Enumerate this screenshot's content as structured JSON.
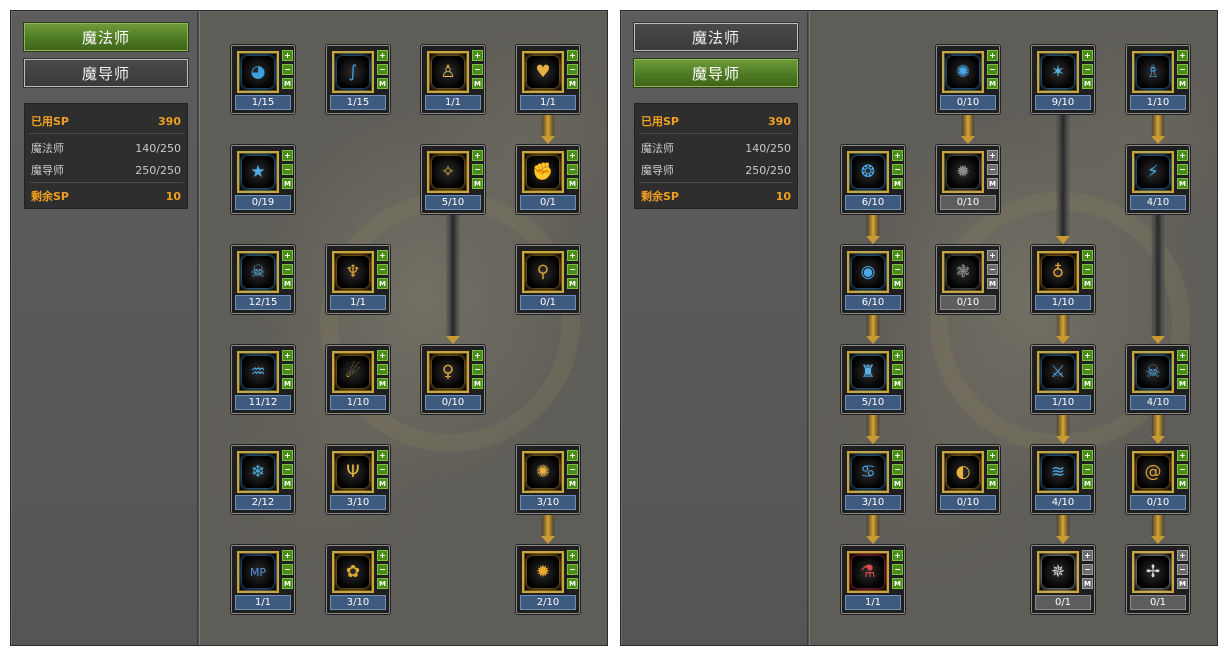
{
  "panels": [
    {
      "tabs": [
        {
          "label": "魔法师",
          "active": true
        },
        {
          "label": "魔导师",
          "active": false
        }
      ],
      "sp": {
        "used_label": "已用SP",
        "used_value": "390",
        "classes": [
          {
            "name": "魔法师",
            "value": "140/250"
          },
          {
            "name": "魔导师",
            "value": "250/250"
          }
        ],
        "remain_label": "剩余SP",
        "remain_value": "10"
      },
      "skills": [
        {
          "icon": "shield-orb-icon",
          "glyph": "◕",
          "color": "#3aa0e0",
          "level": "1/15"
        },
        {
          "icon": "swirl-sword-icon",
          "glyph": "∫",
          "color": "#4a9ad8",
          "level": "1/15"
        },
        {
          "icon": "walking-figure-icon",
          "glyph": "♙",
          "color": "#e0b050",
          "level": "1/1"
        },
        {
          "icon": "golden-heart-icon",
          "glyph": "♥",
          "color": "#e8b040",
          "level": "1/1"
        },
        {
          "icon": "star-burst-icon",
          "glyph": "★",
          "color": "#4ab0e8",
          "level": "0/19"
        },
        {
          "icon": "golden-compass-icon",
          "glyph": "✧",
          "color": "#d8a030",
          "level": "5/10"
        },
        {
          "icon": "golden-fist-icon",
          "glyph": "✊",
          "color": "#e0a838",
          "level": "0/1"
        },
        {
          "icon": "skull-icon",
          "glyph": "☠",
          "color": "#58b8e8",
          "level": "12/15"
        },
        {
          "icon": "golden-totem-icon",
          "glyph": "♆",
          "color": "#e0a030",
          "level": "1/1"
        },
        {
          "icon": "golden-arm-icon",
          "glyph": "⚲",
          "color": "#d8a030",
          "level": "0/1"
        },
        {
          "icon": "ice-demon-icon",
          "glyph": "♒",
          "color": "#4aa8e0",
          "level": "11/12"
        },
        {
          "icon": "fire-orb-icon",
          "glyph": "☄",
          "color": "#e0a030",
          "level": "1/10"
        },
        {
          "icon": "golden-man-icon",
          "glyph": "♀",
          "color": "#d8a838",
          "level": "0/10"
        },
        {
          "icon": "ice-crystal-icon",
          "glyph": "❄",
          "color": "#4ab0e8",
          "level": "2/12"
        },
        {
          "icon": "golden-claw-icon",
          "glyph": "Ψ",
          "color": "#e0b040",
          "level": "3/10"
        },
        {
          "icon": "golden-lotus-icon",
          "glyph": "✺",
          "color": "#e8b040",
          "level": "3/10"
        },
        {
          "icon": "mp-potion-icon",
          "glyph": "MP",
          "color": "#4a90e0",
          "level": "1/1"
        },
        {
          "icon": "golden-flower-icon",
          "glyph": "✿",
          "color": "#e0a838",
          "level": "3/10"
        },
        {
          "icon": "golden-flame-icon",
          "glyph": "✹",
          "color": "#e8a830",
          "level": "2/10"
        }
      ]
    },
    {
      "tabs": [
        {
          "label": "魔法师",
          "active": false
        },
        {
          "label": "魔导师",
          "active": true
        }
      ],
      "sp": {
        "used_label": "已用SP",
        "used_value": "390",
        "classes": [
          {
            "name": "魔法师",
            "value": "140/250"
          },
          {
            "name": "魔导师",
            "value": "250/250"
          }
        ],
        "remain_label": "剩余SP",
        "remain_value": "10"
      },
      "skills": [
        {
          "icon": "frost-sphere-icon",
          "glyph": "✺",
          "color": "#48a8e8",
          "level": "0/10"
        },
        {
          "icon": "ice-wings-icon",
          "glyph": "✶",
          "color": "#58b0e8",
          "level": "9/10"
        },
        {
          "icon": "ice-figure-icon",
          "glyph": "♗",
          "color": "#48a0e0",
          "level": "1/10"
        },
        {
          "icon": "bubble-orbs-icon",
          "glyph": "❂",
          "color": "#4aa8e8",
          "level": "6/10"
        },
        {
          "icon": "dark-orb-icon",
          "glyph": "✹",
          "color": "#8a8a8a",
          "level": "0/10"
        },
        {
          "icon": "ice-burst-icon",
          "glyph": "⚡",
          "color": "#4aa8e8",
          "level": "4/10"
        },
        {
          "icon": "spiral-ice-icon",
          "glyph": "◉",
          "color": "#4aa8e8",
          "level": "6/10"
        },
        {
          "icon": "dark-vortex-icon",
          "glyph": "❃",
          "color": "#8a8a8a",
          "level": "0/10"
        },
        {
          "icon": "golden-pot-icon",
          "glyph": "♁",
          "color": "#e0a030",
          "level": "1/10"
        },
        {
          "icon": "ice-tower-icon",
          "glyph": "♜",
          "color": "#58b0e8",
          "level": "5/10"
        },
        {
          "icon": "ice-blade-icon",
          "glyph": "⚔",
          "color": "#4aa0e0",
          "level": "1/10"
        },
        {
          "icon": "ice-skull-icon",
          "glyph": "☠",
          "color": "#58b0e8",
          "level": "4/10"
        },
        {
          "icon": "ice-mask-icon",
          "glyph": "♋",
          "color": "#4aa8e8",
          "level": "3/10"
        },
        {
          "icon": "golden-ring-icon",
          "glyph": "◐",
          "color": "#e8b040",
          "level": "0/10"
        },
        {
          "icon": "ice-wave-icon",
          "glyph": "≋",
          "color": "#48a8e8",
          "level": "4/10"
        },
        {
          "icon": "golden-spiral-icon",
          "glyph": "@",
          "color": "#e0a030",
          "level": "0/10"
        },
        {
          "icon": "red-potion-icon",
          "glyph": "⚗",
          "color": "#e04848",
          "level": "1/1"
        },
        {
          "icon": "white-spikes-icon",
          "glyph": "✵",
          "color": "#d8d8d8",
          "level": "0/1"
        },
        {
          "icon": "white-knot-icon",
          "glyph": "✢",
          "color": "#d8d8d8",
          "level": "0/1"
        }
      ]
    }
  ]
}
